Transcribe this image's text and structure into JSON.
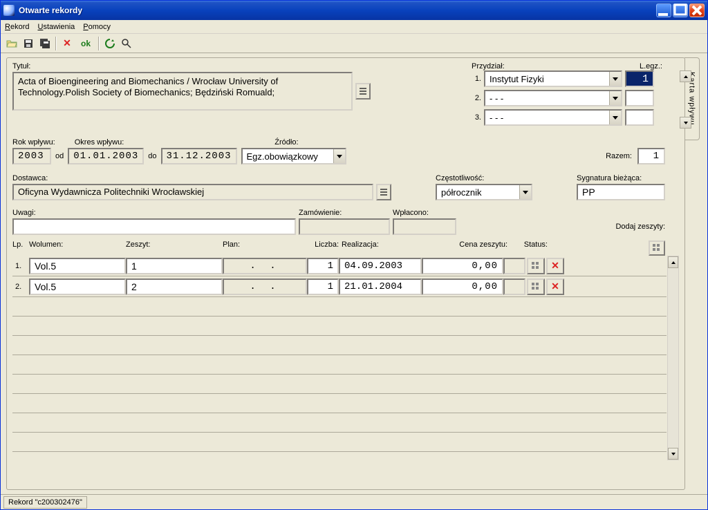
{
  "window": {
    "title": "Otwarte rekordy"
  },
  "menu": {
    "rekord": "Rekord",
    "ustawienia": "Ustawienia",
    "pomocy": "Pomocy"
  },
  "toolbar": {
    "ok": "ok"
  },
  "labels": {
    "tytul": "Tytuł:",
    "przydzial": "Przydział:",
    "legz": "L.egz.:",
    "rok": "Rok wpływu:",
    "okres": "Okres wpływu:",
    "od": "od",
    "do": "do",
    "zrodlo": "Źródło:",
    "razem": "Razem:",
    "dostawca": "Dostawca:",
    "czest": "Częstotliwość:",
    "sygn": "Sygnatura bieżąca:",
    "uwagi": "Uwagi:",
    "zamow": "Zamówienie:",
    "wplac": "Wpłacono:",
    "dodaj": "Dodaj zeszyty:",
    "lp": "Lp.",
    "wolumen": "Wolumen:",
    "zeszyt": "Zeszyt:",
    "plan": "Plan:",
    "liczba": "Liczba:",
    "real": "Realizacja:",
    "cena": "Cena zeszytu:",
    "status": "Status:"
  },
  "form": {
    "tytul": "Acta of Bioengineering and Biomechanics / Wrocław University of Technology.Polish Society of Biomechanics; Będziński Romuald;",
    "rok": "2003",
    "od": "01.01.2003",
    "do": "31.12.2003",
    "zrodlo": "Egz.obowiązkowy",
    "razem": "1",
    "dostawca": "Oficyna Wydawnicza Politechniki Wrocławskiej",
    "czest": "półrocznik",
    "sygn": "PP",
    "uwagi": "",
    "zamow": "",
    "wplac": ""
  },
  "alloc": [
    {
      "idx": "1.",
      "name": "Instytut Fizyki",
      "qty": "1"
    },
    {
      "idx": "2.",
      "name": "- - -",
      "qty": ""
    },
    {
      "idx": "3.",
      "name": "- - -",
      "qty": ""
    }
  ],
  "issues": [
    {
      "lp": "1.",
      "vol": "Vol.5",
      "zesz": "1",
      "plan": ".  .",
      "licz": "1",
      "real": "04.09.2003",
      "cena": "0,00",
      "stat": ""
    },
    {
      "lp": "2.",
      "vol": "Vol.5",
      "zesz": "2",
      "plan": ".  .",
      "licz": "1",
      "real": "21.01.2004",
      "cena": "0,00",
      "stat": ""
    }
  ],
  "sidetab": "Karta wpływu",
  "status": "Rekord \"c200302476\""
}
